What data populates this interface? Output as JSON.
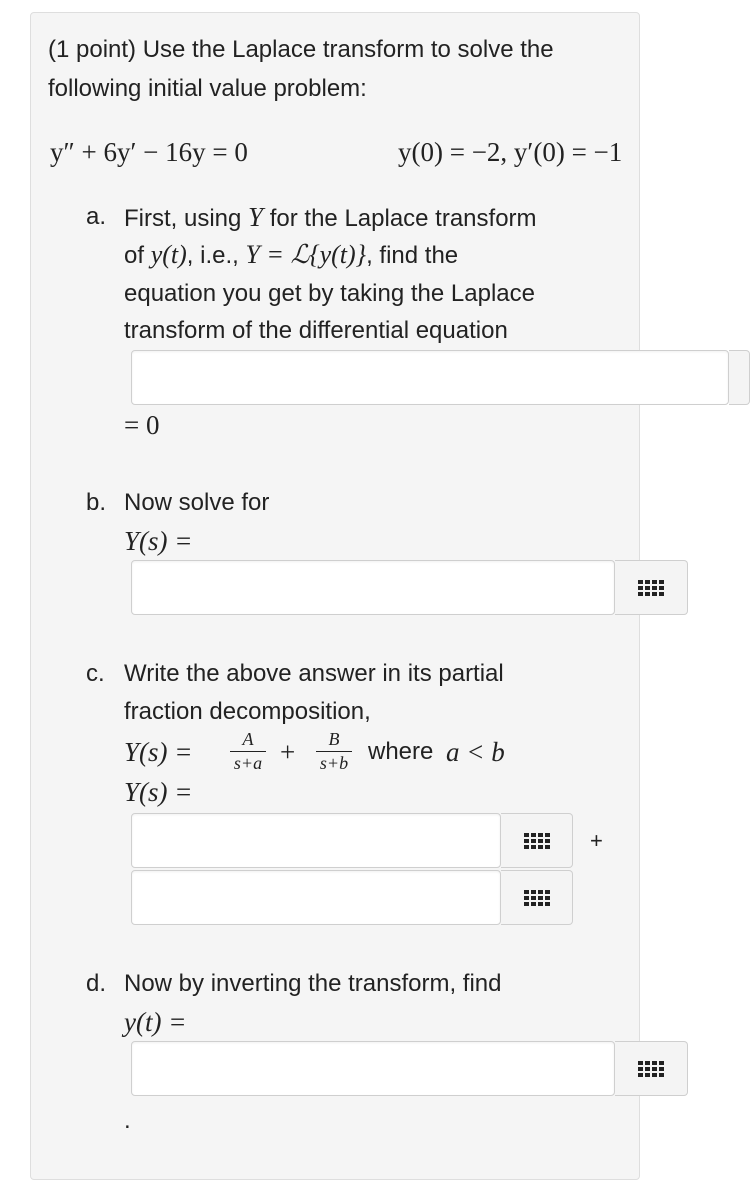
{
  "intro": {
    "line1": "(1 point) Use the Laplace transform to solve the",
    "line2": "following initial value problem:"
  },
  "equation": {
    "ode": "y″ + 6y′ − 16y = 0",
    "initial": "y(0) = −2,  y′(0) = −1"
  },
  "part_a": {
    "marker": "a.",
    "line1_pre": "First, using ",
    "line1_var": "Y",
    "line1_post": " for the Laplace transform",
    "line2_pre": "of ",
    "line2_math": "y(t)",
    "line2_mid": ", i.e., ",
    "line2_math2": "Y = ℒ{y(t)}",
    "line2_post": ", find the",
    "line3": "equation you get by taking the Laplace",
    "line4": "transform of the differential equation",
    "suffix": "= 0"
  },
  "part_b": {
    "marker": "b.",
    "line1": "Now solve for",
    "label": "Y(s) ="
  },
  "part_c": {
    "marker": "c.",
    "line1": "Write the above answer in its partial",
    "line2": "fraction decomposition,",
    "formula_lhs": "Y(s) =",
    "frac1_num": "A",
    "frac1_den": "s+a",
    "plus": "+",
    "frac2_num": "B",
    "frac2_den": "s+b",
    "where_text": "where",
    "where_math": "a < b",
    "label": "Y(s) =",
    "between_plus": "+"
  },
  "part_d": {
    "marker": "d.",
    "line1": "Now by inverting the transform, find",
    "label": "y(t) =",
    "trailing": "."
  },
  "icons": {
    "matrix_button": "grid-icon"
  }
}
